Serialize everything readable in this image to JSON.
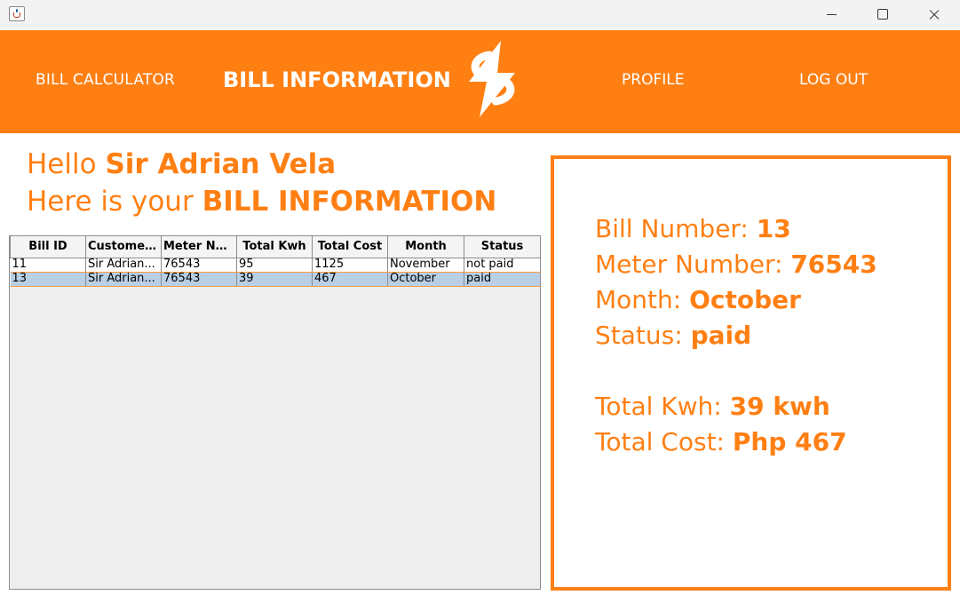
{
  "nav": {
    "bill_calculator": "BILL CALCULATOR",
    "bill_information": "BILL INFORMATION",
    "profile": "PROFILE",
    "log_out": "LOG OUT"
  },
  "greeting": {
    "hello": "Hello",
    "name": "Sir Adrian Vela",
    "here_is": "Here is your",
    "bill_info": "BILL INFORMATION"
  },
  "table": {
    "headers": [
      "Bill ID",
      "Customer...",
      "Meter Nu...",
      "Total Kwh",
      "Total Cost",
      "Month",
      "Status"
    ],
    "rows": [
      [
        "11",
        "Sir Adrian...",
        "76543",
        "95",
        "1125",
        "November",
        "not paid"
      ],
      [
        "13",
        "Sir Adrian...",
        "76543",
        "39",
        "467",
        "October",
        "paid"
      ]
    ]
  },
  "info": {
    "bill_number_label": "Bill Number:",
    "bill_number": "13",
    "meter_number_label": "Meter Number:",
    "meter_number": "76543",
    "month_label": "Month:",
    "month": "October",
    "status_label": "Status:",
    "status": "paid",
    "total_kwh_label": "Total Kwh:",
    "total_kwh": "39 kwh",
    "total_cost_label": "Total Cost:",
    "total_cost": "Php 467"
  },
  "colors": {
    "accent": "#ff7f13",
    "selected_row": "#b8cfe5"
  }
}
